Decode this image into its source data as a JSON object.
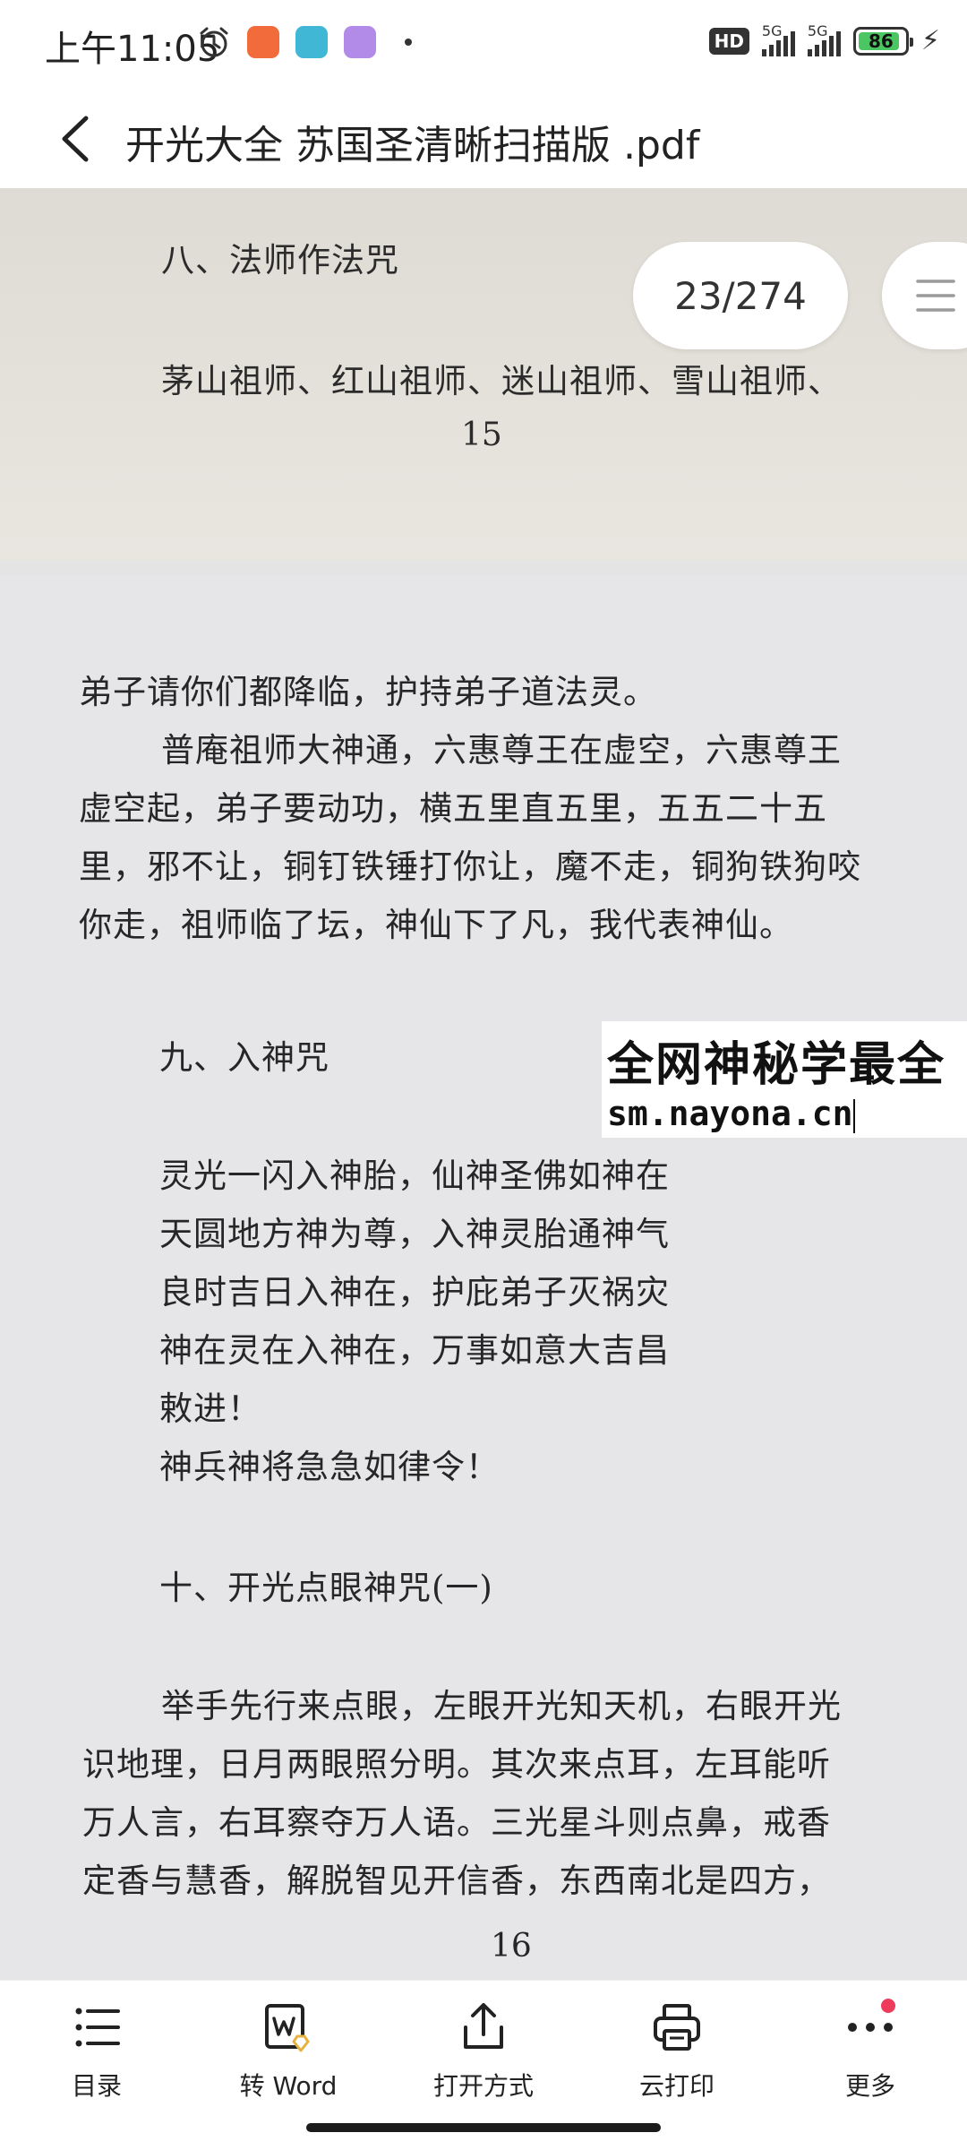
{
  "status_bar": {
    "time": "上午11:05",
    "hd_label": "HD",
    "signal1_label": "5G",
    "signal2_label": "5G",
    "battery": "86"
  },
  "header": {
    "title": "开光大全  苏国圣清晰扫描版 .pdf"
  },
  "viewer": {
    "page_indicator": "23/274",
    "top_page": {
      "heading": "八、法师作法咒",
      "line1": "茅山祖师、红山祖师、迷山祖师、雪山祖师、",
      "page_number": "15"
    },
    "bottom_page": {
      "lines": [
        "弟子请你们都降临，护持弟子道法灵。",
        "普庵祖师大神通，六惠尊王在虚空，六惠尊王",
        "虚空起，弟子要动功，横五里直五里，五五二十五",
        "里，邪不让，铜钉铁锤打你让，魔不走，铜狗铁狗咬",
        "你走，祖师临了坛，神仙下了凡，我代表神仙。"
      ],
      "section9_heading": "九、入神咒",
      "verse": [
        "灵光一闪入神胎，仙神圣佛如神在",
        "天圆地方神为尊，入神灵胎通神气",
        "良时吉日入神在，护庇弟子灭祸灾",
        "神在灵在入神在，万事如意大吉昌",
        "敕进！",
        "神兵神将急急如律令！"
      ],
      "section10_heading": "十、开光点眼神咒(一)",
      "para10": [
        "举手先行来点眼，左眼开光知天机，右眼开光",
        "识地理，日月两眼照分明。其次来点耳，左耳能听",
        "万人言，右耳察夺万人语。三光星斗则点鼻，戒香",
        "定香与慧香，解脱智见开信香，东西南北是四方，"
      ],
      "page_number": "16"
    },
    "watermark": {
      "line1": "全网神秘学最全",
      "line2": "sm.nayona.cn"
    }
  },
  "toolbar": {
    "items": [
      {
        "label": "目录",
        "icon": "toc-list-icon"
      },
      {
        "label": "转 Word",
        "icon": "convert-word-icon"
      },
      {
        "label": "打开方式",
        "icon": "share-icon"
      },
      {
        "label": "云打印",
        "icon": "printer-icon"
      },
      {
        "label": "更多",
        "icon": "more-icon"
      }
    ]
  }
}
